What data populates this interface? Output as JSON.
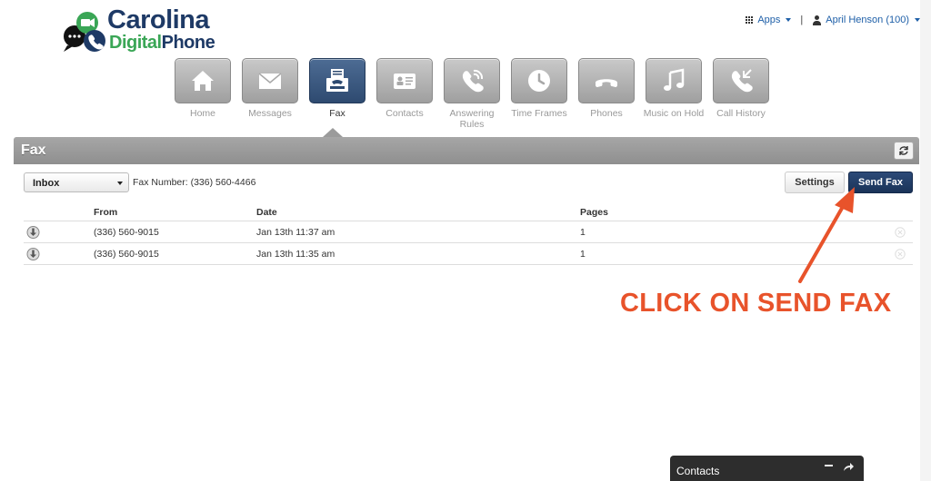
{
  "brand": {
    "name_line1": "Carolina",
    "name_digital": "Digital",
    "name_phone": "Phone",
    "colors": {
      "navy": "#1e3a66",
      "green": "#3aa656",
      "black": "#111111"
    }
  },
  "topbar": {
    "apps_label": "Apps",
    "user_label": "April Henson (100)"
  },
  "nav": {
    "items": [
      {
        "label": "Home",
        "icon": "home-icon"
      },
      {
        "label": "Messages",
        "icon": "envelope-icon"
      },
      {
        "label": "Fax",
        "icon": "fax-icon",
        "active": true
      },
      {
        "label": "Contacts",
        "icon": "contact-card-icon"
      },
      {
        "label": "Answering Rules",
        "icon": "phone-rules-icon"
      },
      {
        "label": "Time Frames",
        "icon": "clock-icon"
      },
      {
        "label": "Phones",
        "icon": "phone-handset-icon"
      },
      {
        "label": "Music on Hold",
        "icon": "music-note-icon"
      },
      {
        "label": "Call History",
        "icon": "call-history-icon"
      }
    ]
  },
  "panel": {
    "title": "Fax",
    "folder_select": "Inbox",
    "fax_number": "Fax Number: (336) 560-4466",
    "settings_label": "Settings",
    "send_fax_label": "Send Fax"
  },
  "table": {
    "columns": {
      "from": "From",
      "date": "Date",
      "pages": "Pages"
    },
    "rows": [
      {
        "from": "(336) 560-9015",
        "date": "Jan 13th 11:37 am",
        "pages": "1"
      },
      {
        "from": "(336) 560-9015",
        "date": "Jan 13th 11:35 am",
        "pages": "1"
      }
    ]
  },
  "annotation": {
    "text": "CLICK ON SEND FAX",
    "color": "#e8532b"
  },
  "dock": {
    "title": "Contacts"
  },
  "colors": {
    "active_tab": "#2e4a70",
    "send_fax_button": "#1a3358",
    "titlebar": "#999999",
    "link": "#1e5fa8"
  }
}
